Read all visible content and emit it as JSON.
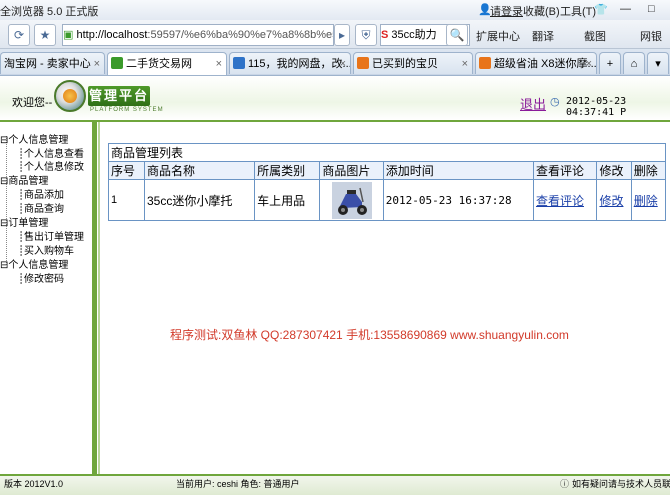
{
  "browser": {
    "title": "全浏览器 5.0 正式版",
    "login": "请登录",
    "favorites": "收藏(B)",
    "tools": "工具(T)",
    "url_host": "http://localhost",
    "url_path": ":59597/%e6%ba%90%e7%a8%8b%e5",
    "search_value": "35cc助力",
    "toolbar": [
      "扩展中心",
      "翻译",
      "截图",
      "网银"
    ],
    "tabs": [
      {
        "label": "淘宝网 - 卖家中心",
        "icon": "taobao-icon"
      },
      {
        "label": "二手货交易网",
        "icon": "page-icon"
      },
      {
        "label": "115，我的网盘，改...",
        "icon": "disk-icon"
      },
      {
        "label": "已买到的宝贝",
        "icon": "taobao-icon"
      },
      {
        "label": "超级省油 X8迷你摩...",
        "icon": "taobao-icon"
      }
    ]
  },
  "header": {
    "welcome": "欢迎您--",
    "logo_text": "管理平台",
    "logo_sub": "PLATFORM SYSTEM",
    "logout": "退出",
    "datetime": "2012-05-23 04:37:41 P"
  },
  "sidebar": {
    "groups": [
      {
        "label": "个人信息管理",
        "items": [
          "个人信息查看",
          "个人信息修改"
        ]
      },
      {
        "label": "商品管理",
        "items": [
          "商品添加",
          "商品查询"
        ]
      },
      {
        "label": "订单管理",
        "items": [
          "售出订单管理",
          "买入购物车"
        ]
      },
      {
        "label": "个人信息管理",
        "items": [
          "修改密码"
        ]
      }
    ]
  },
  "grid": {
    "caption": "商品管理列表",
    "columns": [
      "序号",
      "商品名称",
      "所属类别",
      "商品图片",
      "添加时间",
      "查看评论",
      "修改",
      "删除"
    ],
    "rows": [
      {
        "id": "1",
        "name": "35cc迷你小摩托",
        "category": "车上用品",
        "added": "2012-05-23 16:37:28",
        "view": "查看评论",
        "edit": "修改",
        "delete": "删除"
      }
    ]
  },
  "watermark": "程序测试:双鱼林 QQ:287307421 手机:13558690869 www.shuangyulin.com",
  "footer": {
    "version": "版本 2012V1.0",
    "user": "当前用户: ceshi 角色: 普通用户",
    "help": "如有疑问请与技术人员联系"
  }
}
